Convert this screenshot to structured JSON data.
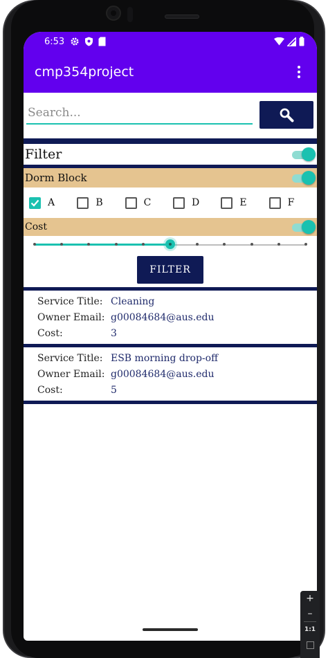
{
  "status_bar": {
    "time": "6:53",
    "left_icons": [
      "gear-icon",
      "shield-icon",
      "sd-card-icon"
    ],
    "right_icons": [
      "wifi-icon",
      "signal-icon",
      "battery-icon"
    ]
  },
  "app_bar": {
    "title": "cmp354project",
    "menu_icon": "overflow-menu-icon"
  },
  "search": {
    "placeholder": "Search...",
    "value": "",
    "button_icon": "search-icon"
  },
  "filter": {
    "label": "Filter",
    "enabled": true
  },
  "dorm_block": {
    "label": "Dorm Block",
    "enabled": true,
    "options": [
      {
        "label": "A",
        "checked": true
      },
      {
        "label": "B",
        "checked": false
      },
      {
        "label": "C",
        "checked": false
      },
      {
        "label": "D",
        "checked": false
      },
      {
        "label": "E",
        "checked": false
      },
      {
        "label": "F",
        "checked": false
      }
    ]
  },
  "cost": {
    "label": "Cost",
    "enabled": true,
    "slider": {
      "steps": 10,
      "value_step": 5
    }
  },
  "filter_button": {
    "label": "FILTER"
  },
  "results": [
    {
      "title_label": "Service Title:",
      "title": "Cleaning",
      "email_label": "Owner Email:",
      "email": "g00084684@aus.edu",
      "cost_label": "Cost:",
      "cost": "3"
    },
    {
      "title_label": "Service Title:",
      "title": "ESB morning drop-off",
      "email_label": "Owner Email:",
      "email": "g00084684@aus.edu",
      "cost_label": "Cost:",
      "cost": "5"
    }
  ],
  "emulator_zoom": {
    "zoom_in": "+",
    "zoom_out": "–",
    "reset": "1:1"
  },
  "colors": {
    "primary": "#6200ee",
    "accent": "#1ac1b0",
    "navy": "#0f1a55",
    "section_bg": "#e5c490"
  }
}
